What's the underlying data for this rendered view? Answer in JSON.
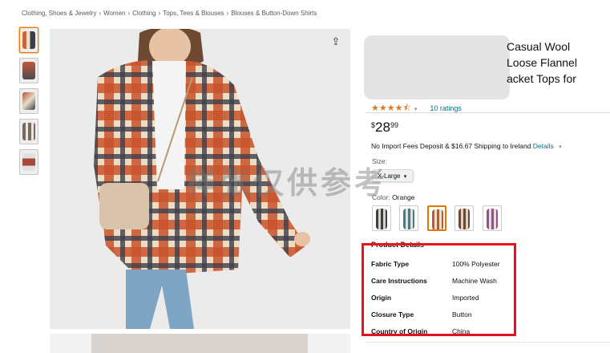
{
  "breadcrumb": [
    "Clothing, Shoes & Jewelry",
    "Women",
    "Clothing",
    "Tops, Tees & Blouses",
    "Blouses & Button-Down Shirts"
  ],
  "breadcrumb_separator": "›",
  "product": {
    "title_visible": "Casual Wool Loose Flannel acket Tops for",
    "title_lines": [
      "Casual Wool",
      "Loose Flannel",
      "acket Tops for"
    ],
    "rating_stars": "★★★★⯪",
    "ratings_count": "10 ratings",
    "price_currency": "$",
    "price_whole": "28",
    "price_fraction": "99",
    "shipping_text": "No Import Fees Deposit & $16.67 Shipping to Ireland",
    "shipping_link": "Details",
    "size_label": "Size:",
    "size_value": "X-Large",
    "color_label": "Color:",
    "color_value": "Orange"
  },
  "product_details": {
    "title": "Product Details",
    "rows": [
      {
        "key": "Fabric Type",
        "value": "100% Polyester"
      },
      {
        "key": "Care Instructions",
        "value": "Machine Wash"
      },
      {
        "key": "Origin",
        "value": "Imported"
      },
      {
        "key": "Closure Type",
        "value": "Button"
      },
      {
        "key": "Country of Origin",
        "value": "China"
      }
    ]
  },
  "watermark": "样张仅供参考",
  "icons": {
    "share": "share-icon",
    "caret": "caret-down-icon",
    "select_caret": "chevron-down-icon"
  },
  "colors": {
    "accent": "#e77600",
    "link": "#007185",
    "star": "#de7921",
    "highlight_box": "#e8121a"
  },
  "swatch_colors": [
    "#3b3f49",
    "#3f7c8e",
    "#c4562e",
    "#6a4a34",
    "#9a4f8a"
  ]
}
